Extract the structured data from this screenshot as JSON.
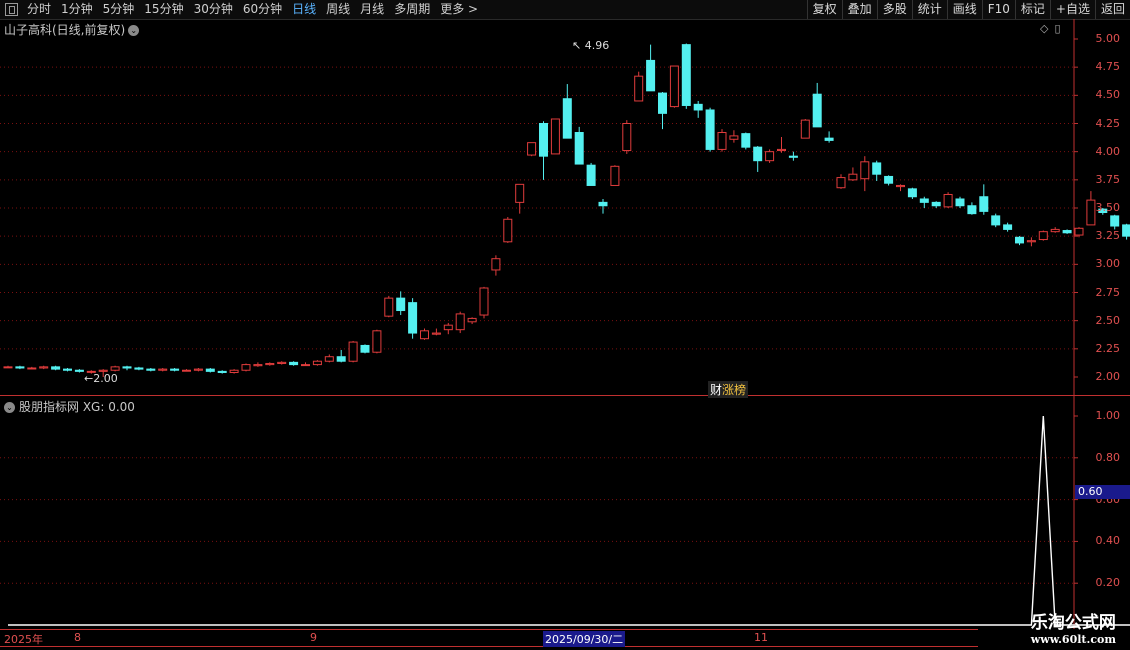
{
  "toolbar": {
    "periods": [
      "分时",
      "1分钟",
      "5分钟",
      "15分钟",
      "30分钟",
      "60分钟",
      "日线",
      "周线",
      "月线",
      "多周期",
      "更多 >"
    ],
    "active_period": "日线",
    "right_buttons": [
      "复权",
      "叠加",
      "多股",
      "统计",
      "画线",
      "F10",
      "标记",
      "+自选",
      "返回"
    ]
  },
  "main_chart": {
    "title": "山子高科(日线,前复权)",
    "y_labels": [
      "5.00",
      "4.75",
      "4.50",
      "4.25",
      "4.00",
      "3.75",
      "3.50",
      "3.25",
      "3.00",
      "2.75",
      "2.50",
      "2.25",
      "2.00"
    ],
    "high_note": "4.96",
    "low_note": "2.00",
    "badge_prefix": "财",
    "badge_text": "涨榜",
    "colors": {
      "up": "#e03c3c",
      "down": "#54f0f0",
      "grid": "#7a1010",
      "axis": "#c03030"
    }
  },
  "sub_chart": {
    "title": "股朋指标网 XG: 0.00",
    "y_labels": [
      "1.00",
      "0.80",
      "0.60",
      "0.40",
      "0.20"
    ],
    "current_value": "0.60"
  },
  "date_axis": {
    "labels": [
      "2025年",
      "8",
      "9",
      "11"
    ],
    "selected": "2025/09/30/二"
  },
  "watermark": {
    "line1": "乐淘公式网",
    "line2": "www.60lt.com"
  },
  "chart_data": {
    "type": "candlestick",
    "y_range": [
      1.95,
      5.03
    ],
    "candles": [
      [
        2.09,
        2.09,
        2.1,
        2.08
      ],
      [
        2.09,
        2.08,
        2.1,
        2.07
      ],
      [
        2.08,
        2.08,
        2.09,
        2.07
      ],
      [
        2.08,
        2.09,
        2.1,
        2.07
      ],
      [
        2.09,
        2.07,
        2.1,
        2.06
      ],
      [
        2.07,
        2.06,
        2.08,
        2.05
      ],
      [
        2.06,
        2.05,
        2.07,
        2.04
      ],
      [
        2.05,
        2.05,
        2.06,
        2.03
      ],
      [
        2.05,
        2.06,
        2.07,
        2.0
      ],
      [
        2.06,
        2.09,
        2.1,
        2.05
      ],
      [
        2.09,
        2.08,
        2.1,
        2.06
      ],
      [
        2.08,
        2.07,
        2.09,
        2.06
      ],
      [
        2.07,
        2.06,
        2.08,
        2.05
      ],
      [
        2.06,
        2.07,
        2.08,
        2.05
      ],
      [
        2.07,
        2.06,
        2.08,
        2.05
      ],
      [
        2.06,
        2.06,
        2.07,
        2.05
      ],
      [
        2.06,
        2.07,
        2.08,
        2.05
      ],
      [
        2.07,
        2.05,
        2.08,
        2.04
      ],
      [
        2.05,
        2.04,
        2.06,
        2.03
      ],
      [
        2.04,
        2.06,
        2.07,
        2.03
      ],
      [
        2.06,
        2.11,
        2.12,
        2.05
      ],
      [
        2.1,
        2.11,
        2.13,
        2.09
      ],
      [
        2.11,
        2.12,
        2.13,
        2.1
      ],
      [
        2.12,
        2.13,
        2.14,
        2.11
      ],
      [
        2.13,
        2.11,
        2.14,
        2.1
      ],
      [
        2.11,
        2.11,
        2.13,
        2.1
      ],
      [
        2.11,
        2.14,
        2.15,
        2.1
      ],
      [
        2.14,
        2.18,
        2.2,
        2.13
      ],
      [
        2.18,
        2.14,
        2.24,
        2.13
      ],
      [
        2.14,
        2.31,
        2.32,
        2.13
      ],
      [
        2.28,
        2.22,
        2.29,
        2.21
      ],
      [
        2.22,
        2.41,
        2.42,
        2.21
      ],
      [
        2.54,
        2.7,
        2.72,
        2.53
      ],
      [
        2.7,
        2.59,
        2.76,
        2.55
      ],
      [
        2.66,
        2.39,
        2.7,
        2.34
      ],
      [
        2.34,
        2.41,
        2.43,
        2.33
      ],
      [
        2.38,
        2.39,
        2.43,
        2.37
      ],
      [
        2.42,
        2.46,
        2.48,
        2.38
      ],
      [
        2.42,
        2.56,
        2.58,
        2.39
      ],
      [
        2.49,
        2.52,
        2.53,
        2.47
      ],
      [
        2.55,
        2.79,
        2.8,
        2.52
      ],
      [
        2.95,
        3.05,
        3.08,
        2.9
      ],
      [
        3.2,
        3.4,
        3.42,
        3.19
      ],
      [
        3.55,
        3.71,
        3.71,
        3.45
      ],
      [
        3.97,
        4.08,
        4.08,
        3.96
      ],
      [
        4.25,
        3.96,
        4.27,
        3.75
      ],
      [
        3.98,
        4.29,
        4.29,
        3.98
      ],
      [
        4.47,
        4.12,
        4.6,
        4.12
      ],
      [
        4.17,
        3.89,
        4.22,
        3.89
      ],
      [
        3.88,
        3.7,
        3.9,
        3.7
      ],
      [
        3.55,
        3.52,
        3.58,
        3.45
      ],
      [
        3.7,
        3.87,
        3.88,
        3.7
      ],
      [
        4.01,
        4.25,
        4.28,
        3.98
      ],
      [
        4.45,
        4.67,
        4.71,
        4.45
      ],
      [
        4.81,
        4.54,
        4.95,
        4.54
      ],
      [
        4.52,
        4.34,
        4.53,
        4.2
      ],
      [
        4.4,
        4.76,
        4.76,
        4.39
      ],
      [
        4.95,
        4.41,
        4.96,
        4.38
      ],
      [
        4.42,
        4.37,
        4.45,
        4.3
      ],
      [
        4.37,
        4.02,
        4.39,
        4.0
      ],
      [
        4.02,
        4.17,
        4.2,
        4.0
      ],
      [
        4.11,
        4.14,
        4.19,
        4.08
      ],
      [
        4.16,
        4.04,
        4.17,
        4.02
      ],
      [
        4.04,
        3.92,
        4.05,
        3.82
      ],
      [
        3.92,
        4.0,
        4.02,
        3.9
      ],
      [
        4.01,
        4.02,
        4.13,
        3.99
      ],
      [
        3.96,
        3.95,
        4.0,
        3.92
      ],
      [
        4.12,
        4.28,
        4.29,
        4.12
      ],
      [
        4.51,
        4.22,
        4.61,
        4.22
      ],
      [
        4.12,
        4.1,
        4.18,
        4.08
      ],
      [
        3.68,
        3.77,
        3.8,
        3.67
      ],
      [
        3.75,
        3.8,
        3.86,
        3.74
      ],
      [
        3.76,
        3.91,
        3.96,
        3.65
      ],
      [
        3.9,
        3.8,
        3.92,
        3.74
      ],
      [
        3.78,
        3.72,
        3.79,
        3.7
      ],
      [
        3.69,
        3.7,
        3.71,
        3.65
      ],
      [
        3.67,
        3.6,
        3.68,
        3.58
      ],
      [
        3.58,
        3.55,
        3.6,
        3.5
      ],
      [
        3.55,
        3.52,
        3.56,
        3.5
      ],
      [
        3.51,
        3.62,
        3.64,
        3.5
      ],
      [
        3.58,
        3.52,
        3.6,
        3.5
      ],
      [
        3.52,
        3.45,
        3.55,
        3.44
      ],
      [
        3.6,
        3.47,
        3.71,
        3.44
      ],
      [
        3.43,
        3.35,
        3.45,
        3.33
      ],
      [
        3.35,
        3.31,
        3.37,
        3.29
      ],
      [
        3.24,
        3.19,
        3.25,
        3.17
      ],
      [
        3.2,
        3.21,
        3.24,
        3.16
      ],
      [
        3.22,
        3.29,
        3.3,
        3.21
      ],
      [
        3.29,
        3.31,
        3.33,
        3.28
      ],
      [
        3.3,
        3.28,
        3.31,
        3.27
      ],
      [
        3.26,
        3.32,
        3.33,
        3.24
      ],
      [
        3.35,
        3.57,
        3.65,
        3.35
      ],
      [
        3.49,
        3.46,
        3.5,
        3.44
      ],
      [
        3.43,
        3.34,
        3.44,
        3.31
      ],
      [
        3.35,
        3.25,
        3.36,
        3.22
      ],
      [
        3.22,
        3.26,
        3.28,
        3.21
      ],
      [
        3.29,
        3.27,
        3.3,
        3.26
      ]
    ],
    "xg_signal": {
      "index": 87,
      "value": 1.0
    },
    "xg_range": [
      0,
      1.05
    ]
  }
}
